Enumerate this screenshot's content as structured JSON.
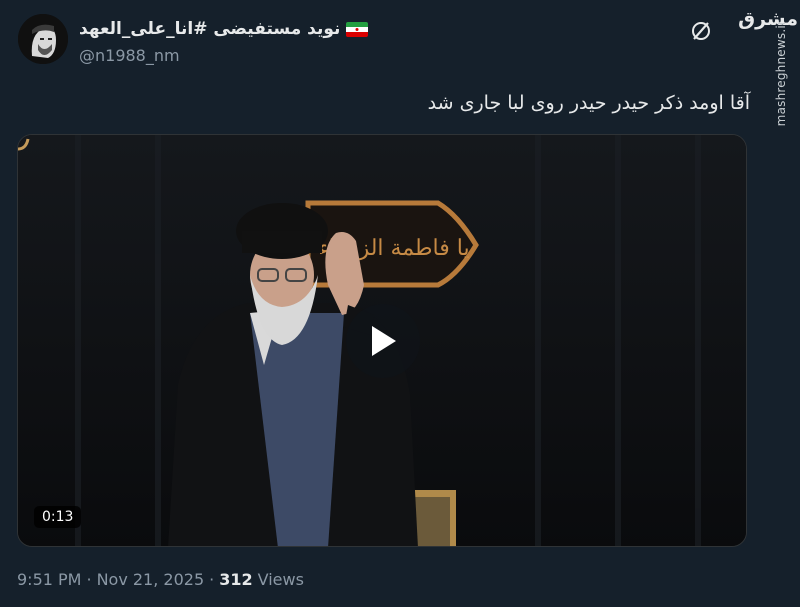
{
  "author": {
    "display_name": "نوید مستفیضی #انا_علی_العهد",
    "handle": "@n1988_nm",
    "flag_icon": "iran-flag-icon"
  },
  "watermark": {
    "logo": "مشرق",
    "site": "mashreghnews.ir"
  },
  "tweet": {
    "text": "آقا اومد ذکر حیدر حیدر روی لبا جاری شد"
  },
  "media": {
    "duration": "0:13",
    "play_icon": "play-icon",
    "banner_text": "یا فاطمة الزهراء"
  },
  "meta": {
    "time": "9:51 PM",
    "separator": "·",
    "date": "Nov 21, 2025",
    "views_count": "312",
    "views_label": "Views"
  },
  "colors": {
    "background": "#15202b",
    "text_primary": "#e7e9ea",
    "text_secondary": "#8b98a5"
  }
}
